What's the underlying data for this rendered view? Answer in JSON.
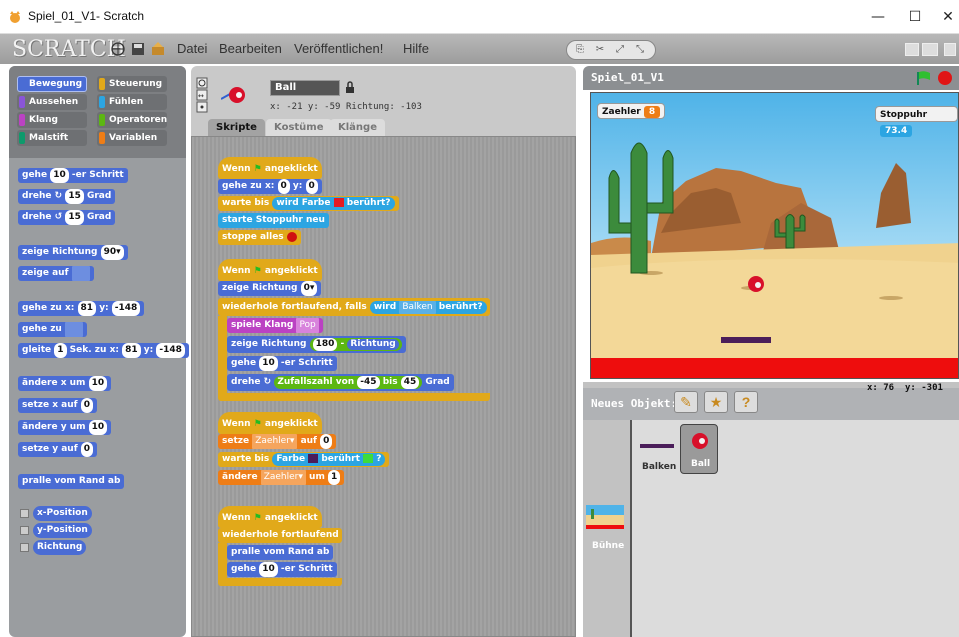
{
  "window": {
    "title": "Spiel_01_V1- Scratch",
    "minimize": "—",
    "maximize": "☐",
    "close": "✕"
  },
  "menubar": {
    "logo": "SCRATCH",
    "menus": [
      "Datei",
      "Bearbeiten",
      "Veröffentlichen!",
      "Hilfe"
    ]
  },
  "categories": [
    {
      "label": "Bewegung",
      "color": "#4a6cd4",
      "selected": true
    },
    {
      "label": "Steuerung",
      "color": "#e1a91a"
    },
    {
      "label": "Aussehen",
      "color": "#8a55d7"
    },
    {
      "label": "Fühlen",
      "color": "#2ca5e2"
    },
    {
      "label": "Klang",
      "color": "#bb42c3"
    },
    {
      "label": "Operatoren",
      "color": "#5cb712"
    },
    {
      "label": "Malstift",
      "color": "#0e9a6c"
    },
    {
      "label": "Variablen",
      "color": "#ee7d16"
    }
  ],
  "palette": {
    "b1": {
      "pre": "gehe",
      "n": "10",
      "post": "-er Schritt"
    },
    "b2": {
      "pre": "drehe ↻",
      "n": "15",
      "post": "Grad"
    },
    "b3": {
      "pre": "drehe ↺",
      "n": "15",
      "post": "Grad"
    },
    "b4": {
      "pre": "zeige Richtung",
      "n": "90▾"
    },
    "b5": {
      "pre": "zeige auf"
    },
    "b6": {
      "pre": "gehe zu x:",
      "x": "81",
      "mid": "y:",
      "y": "-148"
    },
    "b7": {
      "pre": "gehe zu"
    },
    "b8": {
      "pre": "gleite",
      "n": "1",
      "mid": "Sek. zu x:",
      "x": "81",
      "mid2": "y:",
      "y": "-148"
    },
    "b9": {
      "pre": "ändere x um",
      "n": "10"
    },
    "b10": {
      "pre": "setze x auf",
      "n": "0"
    },
    "b11": {
      "pre": "ändere y um",
      "n": "10"
    },
    "b12": {
      "pre": "setze y auf",
      "n": "0"
    },
    "b13": {
      "pre": "pralle vom Rand ab"
    },
    "r1": "x-Position",
    "r2": "y-Position",
    "r3": "Richtung"
  },
  "sprite": {
    "name": "Ball",
    "coords": "x: -21  y: -59",
    "direction": "Richtung: -103"
  },
  "tabs": [
    "Skripte",
    "Kostüme",
    "Klänge"
  ],
  "scripts": {
    "s1": {
      "hat": "Wenn",
      "hat2": "angeklickt",
      "goto_pre": "gehe zu x:",
      "goto_x": "0",
      "goto_mid": "y:",
      "goto_y": "0",
      "wait_pre": "warte bis",
      "wait_in": "wird Farbe",
      "wait_post": "berührt?",
      "timer": "starte Stoppuhr neu",
      "stop": "stoppe alles"
    },
    "s2": {
      "hat": "Wenn",
      "hat2": "angeklickt",
      "dir_pre": "zeige Richtung",
      "dir_n": "0▾",
      "forever_if": "wiederhole fortlaufend, falls",
      "wird": "wird",
      "balken": "Balken",
      "beruhrt": "berührt?",
      "sound_pre": "spiele Klang",
      "sound": "Pop",
      "dir2_pre": "zeige Richtung",
      "dir2_n": "180",
      "dir2_op": "-",
      "dir2_rep": "Richtung",
      "move_pre": "gehe",
      "move_n": "10",
      "move_post": "-er Schritt",
      "turn_pre": "drehe ↻",
      "rand_pre": "Zufallszahl von",
      "rand_a": "-45",
      "rand_mid": "bis",
      "rand_b": "45",
      "turn_post": "Grad"
    },
    "s3": {
      "hat": "Wenn",
      "hat2": "angeklickt",
      "set_pre": "setze",
      "var": "Zaehler▾",
      "set_mid": "auf",
      "set_n": "0",
      "wait_pre": "warte bis",
      "wait_in": "Farbe",
      "wait_mid": "berührt",
      "wait_post": "?",
      "change_pre": "ändere",
      "change_var": "Zaehler▾",
      "change_mid": "um",
      "change_n": "1"
    },
    "s4": {
      "hat": "Wenn",
      "hat2": "angeklickt",
      "forever": "wiederhole fortlaufend",
      "bounce": "pralle vom Rand ab",
      "move_pre": "gehe",
      "move_n": "10",
      "move_post": "-er Schritt"
    }
  },
  "stage": {
    "title": "Spiel_01_V1",
    "counter_label": "Zaehler",
    "counter_value": "8",
    "timer_label": "Stoppuhr",
    "timer_value": "73.4",
    "mouse_x": "x: 76",
    "mouse_y": "y: -301"
  },
  "sprite_panel": {
    "new_sprite_label": "Neues Objekt:",
    "sprites": [
      "Balken",
      "Ball"
    ],
    "stage_label": "Bühne"
  }
}
